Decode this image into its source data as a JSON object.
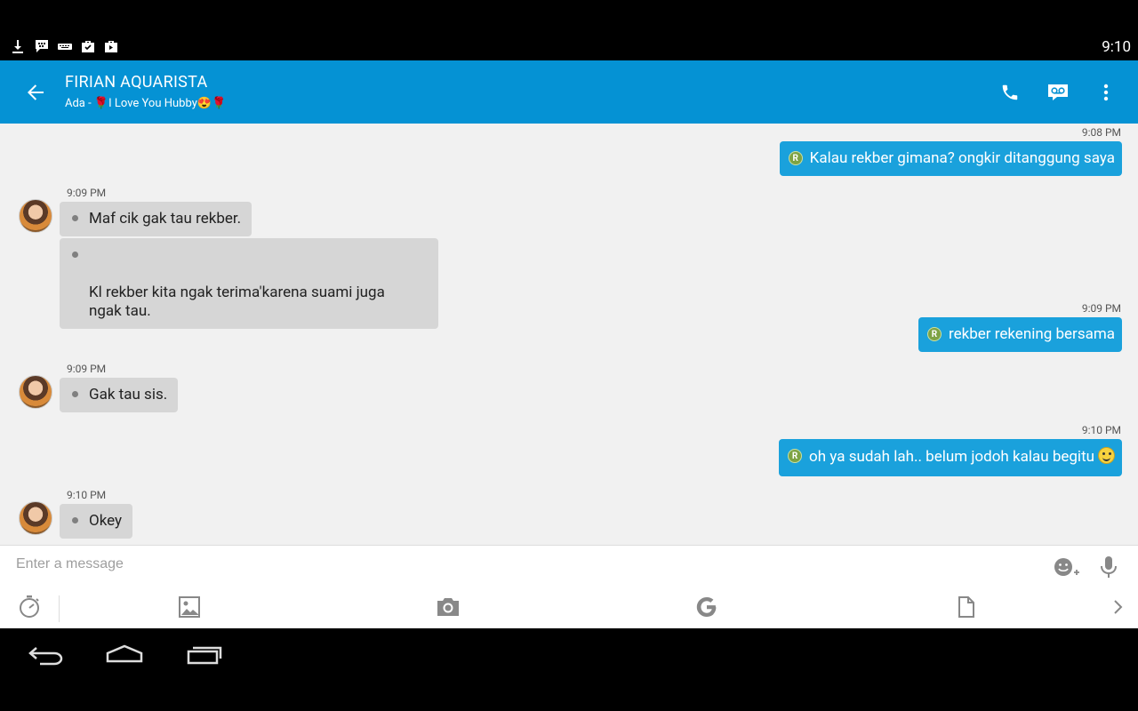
{
  "status_bar": {
    "time": "9:10",
    "icons": [
      "download-icon",
      "bbm-icon",
      "keyboard-icon",
      "briefcase-check-icon",
      "shopping-bag-icon"
    ]
  },
  "header": {
    "contact_name": "FIRIAN AQUARISTA",
    "status_text": "Ada - 🌹I Love You Hubby😍🌹",
    "accent_color": "#0592d4"
  },
  "messages": [
    {
      "direction": "out",
      "time": "9:08 PM",
      "text": "Kalau rekber gimana? ongkir ditanggung saya",
      "badge": "R"
    },
    {
      "direction": "in",
      "time": "9:09 PM",
      "texts": [
        "Maf cik gak tau rekber.",
        "Kl rekber kita ngak terima'karena suami juga\nngak tau."
      ]
    },
    {
      "direction": "out",
      "time": "9:09 PM",
      "text": "rekber rekening bersama",
      "badge": "R"
    },
    {
      "direction": "in",
      "time": "9:09 PM",
      "texts": [
        "Gak tau sis."
      ]
    },
    {
      "direction": "out",
      "time": "9:10 PM",
      "text": "oh ya sudah lah.. belum jodoh kalau begitu",
      "badge": "R"
    },
    {
      "direction": "in",
      "time": "9:10 PM",
      "texts": [
        "Okey"
      ]
    }
  ],
  "composer": {
    "placeholder": "Enter a message",
    "value": ""
  },
  "colors": {
    "outgoing_bubble": "#1aa1dc",
    "incoming_bubble": "#d6d6d6",
    "chat_background": "#f1f1f1"
  }
}
